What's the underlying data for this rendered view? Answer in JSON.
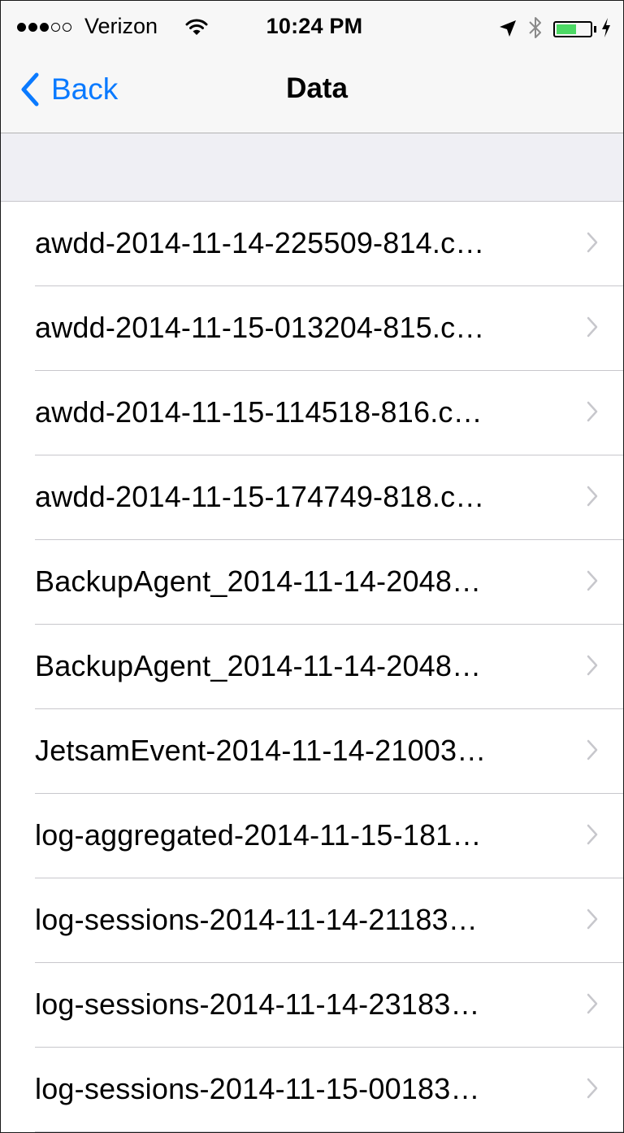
{
  "status_bar": {
    "signal_bars_filled": 3,
    "signal_bars_total": 5,
    "carrier": "Verizon",
    "time": "10:24 PM",
    "battery_level": 0.6,
    "icons": [
      "wifi-icon",
      "location-arrow-icon",
      "bluetooth-icon",
      "battery-icon",
      "charging-bolt-icon"
    ],
    "battery_color": "#4cd964"
  },
  "nav": {
    "back_label": "Back",
    "title": "Data",
    "accent_color": "#0a7aff"
  },
  "files": [
    {
      "label": "awdd-2014-11-14-225509-814.c…"
    },
    {
      "label": "awdd-2014-11-15-013204-815.c…"
    },
    {
      "label": "awdd-2014-11-15-114518-816.c…"
    },
    {
      "label": "awdd-2014-11-15-174749-818.c…"
    },
    {
      "label": "BackupAgent_2014-11-14-2048…"
    },
    {
      "label": "BackupAgent_2014-11-14-2048…"
    },
    {
      "label": "JetsamEvent-2014-11-14-21003…"
    },
    {
      "label": "log-aggregated-2014-11-15-181…"
    },
    {
      "label": "log-sessions-2014-11-14-21183…"
    },
    {
      "label": "log-sessions-2014-11-14-23183…"
    },
    {
      "label": "log-sessions-2014-11-15-00183…"
    }
  ]
}
